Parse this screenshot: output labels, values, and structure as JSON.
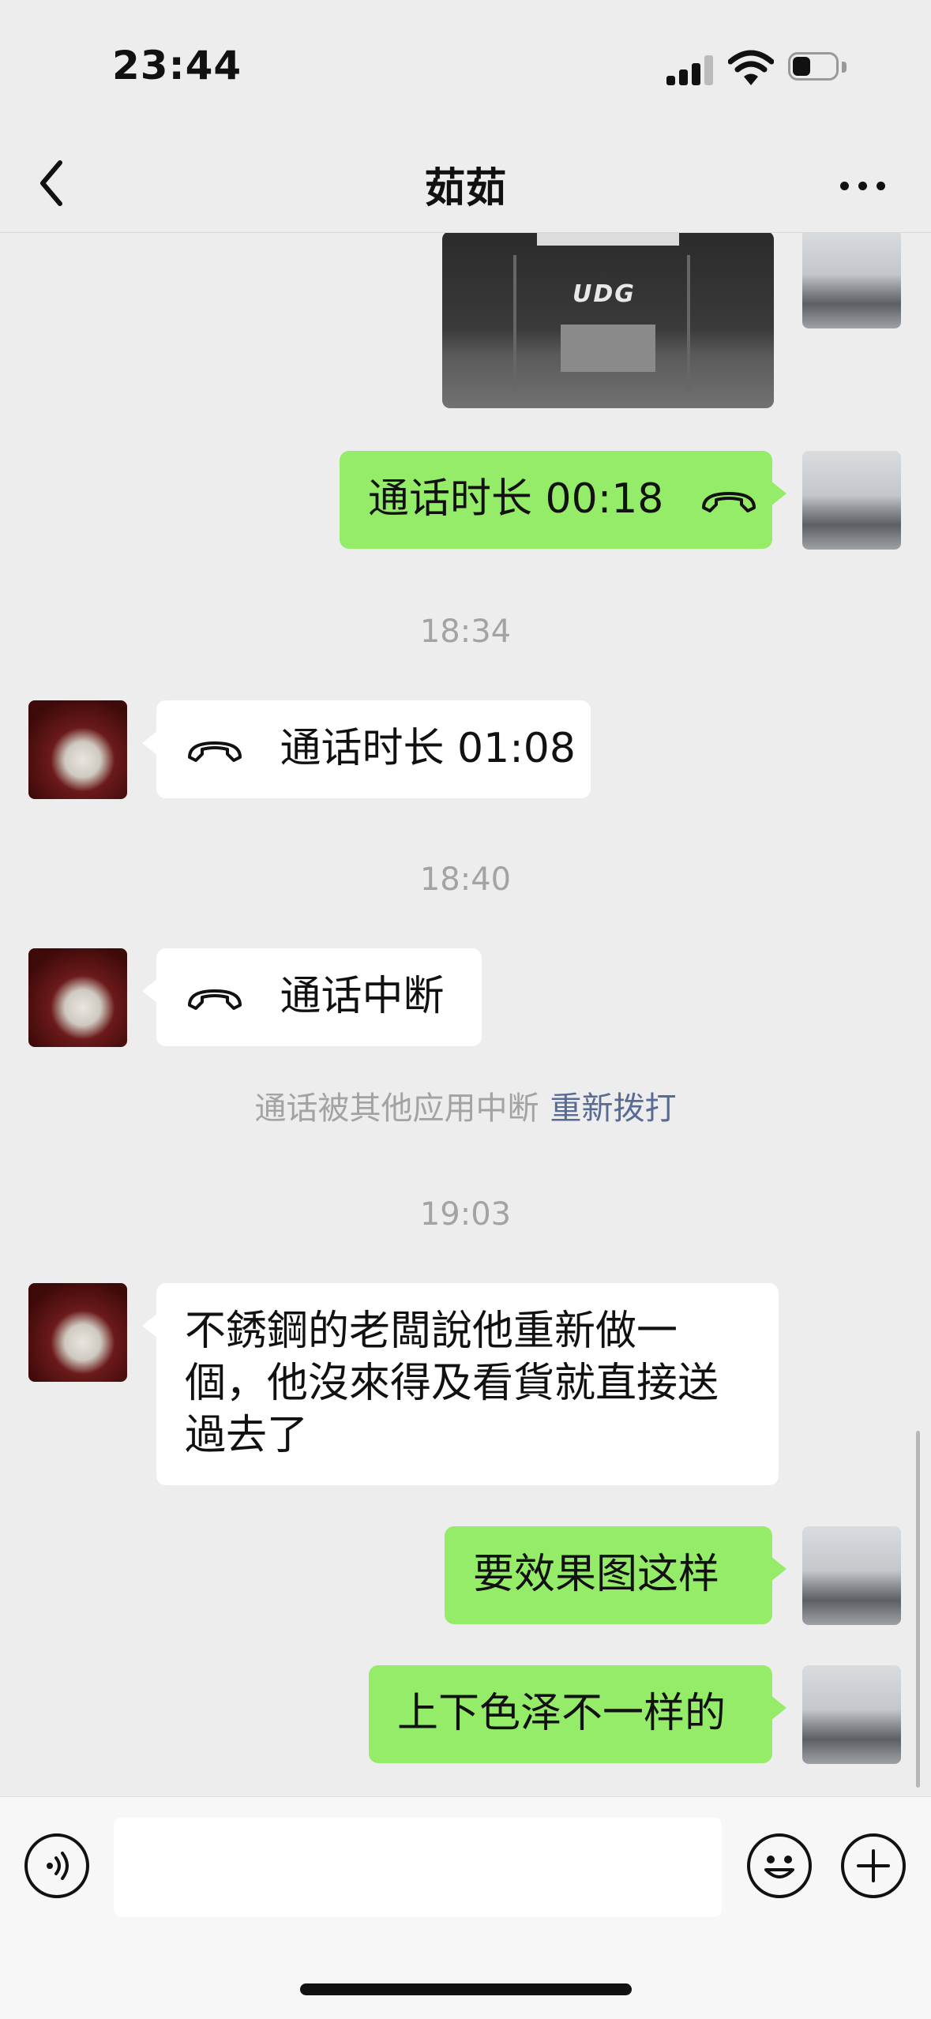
{
  "status_bar": {
    "time": "23:44"
  },
  "nav": {
    "title": "茹茹",
    "back_icon": "chevron-left-icon",
    "more_icon": "more-dots-icon"
  },
  "colors": {
    "self_bubble": "#95ec69",
    "other_bubble": "#ffffff",
    "link": "#576b95",
    "background": "#ededed"
  },
  "messages": [
    {
      "type": "image",
      "from": "self",
      "image_text": "UDG"
    },
    {
      "type": "call",
      "from": "self",
      "text": "通话时长 00:18",
      "icon": "phone-hangup-icon"
    },
    {
      "type": "timestamp",
      "text": "18:34"
    },
    {
      "type": "call",
      "from": "other",
      "text": "通话时长 01:08",
      "icon": "phone-hangup-icon"
    },
    {
      "type": "timestamp",
      "text": "18:40"
    },
    {
      "type": "call",
      "from": "other",
      "text": "通话中断",
      "icon": "phone-hangup-icon"
    },
    {
      "type": "system",
      "text": "通话被其他应用中断",
      "link": "重新拨打"
    },
    {
      "type": "timestamp",
      "text": "19:03"
    },
    {
      "type": "text",
      "from": "other",
      "lines": [
        "不銹鋼的老闆說他重新做一",
        "個，他沒來得及看貨就直接送",
        "過去了"
      ]
    },
    {
      "type": "text",
      "from": "self",
      "text": "要效果图这样"
    },
    {
      "type": "text",
      "from": "self",
      "text": "上下色泽不一样的"
    }
  ],
  "input_bar": {
    "voice_icon": "voice-icon",
    "emoji_icon": "emoji-icon",
    "plus_icon": "plus-icon",
    "value": ""
  }
}
